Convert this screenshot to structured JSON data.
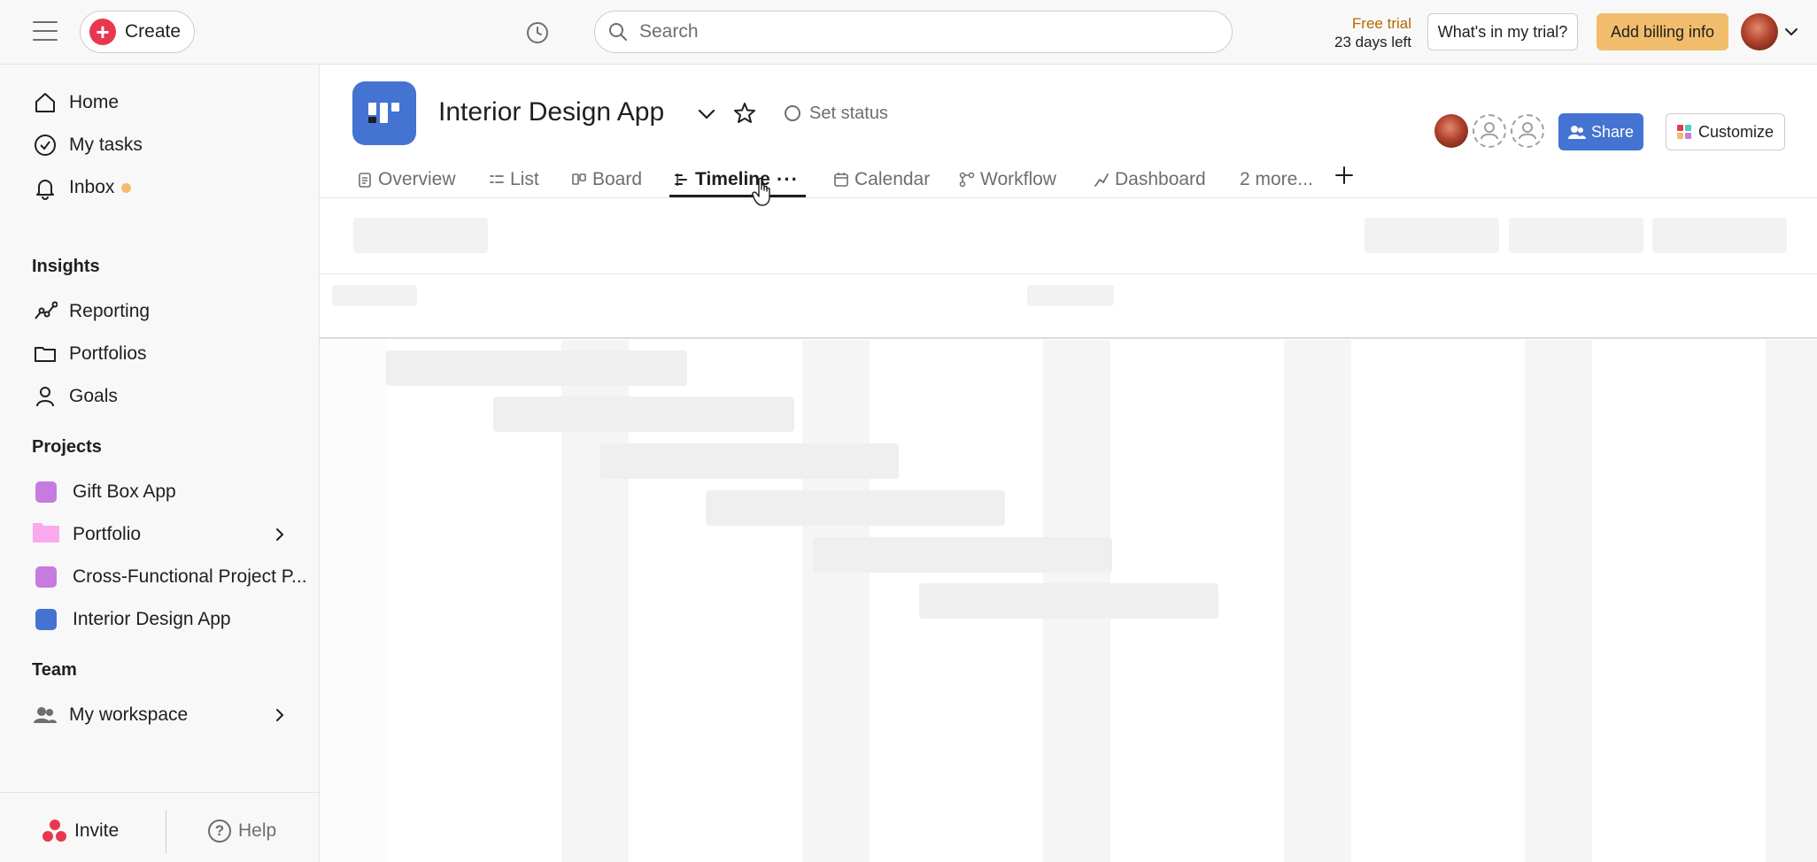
{
  "topbar": {
    "create_label": "Create",
    "search_placeholder": "Search",
    "trial_line1": "Free trial",
    "trial_line2": "23 days left",
    "whats_in_trial": "What's in my trial?",
    "add_billing": "Add billing info"
  },
  "sidebar": {
    "nav": [
      {
        "label": "Home",
        "icon": "home-icon"
      },
      {
        "label": "My tasks",
        "icon": "check-circle-icon"
      },
      {
        "label": "Inbox",
        "icon": "bell-icon"
      }
    ],
    "insights_title": "Insights",
    "insights": [
      {
        "label": "Reporting",
        "icon": "reporting-icon"
      },
      {
        "label": "Portfolios",
        "icon": "folder-icon"
      },
      {
        "label": "Goals",
        "icon": "goals-icon"
      }
    ],
    "projects_title": "Projects",
    "projects": [
      {
        "label": "Gift Box App",
        "color": "#c67be0"
      },
      {
        "label": "Portfolio",
        "color": "#f9aaef"
      },
      {
        "label": "Cross-Functional Project P...",
        "color": "#c67be0"
      },
      {
        "label": "Interior Design App",
        "color": "#4573d2"
      }
    ],
    "team_title": "Team",
    "team": [
      {
        "label": "My workspace",
        "icon": "people-icon"
      }
    ],
    "invite_label": "Invite",
    "help_label": "Help"
  },
  "project": {
    "title": "Interior Design App",
    "set_status": "Set status",
    "share_label": "Share",
    "customize_label": "Customize",
    "accent_color": "#4573d2"
  },
  "tabs": [
    {
      "label": "Overview",
      "icon": "overview-icon"
    },
    {
      "label": "List",
      "icon": "list-icon"
    },
    {
      "label": "Board",
      "icon": "board-icon"
    },
    {
      "label": "Timeline",
      "icon": "timeline-icon",
      "active": true
    },
    {
      "label": "Calendar",
      "icon": "calendar-icon"
    },
    {
      "label": "Workflow",
      "icon": "workflow-icon"
    },
    {
      "label": "Dashboard",
      "icon": "dashboard-icon"
    },
    {
      "label": "2 more...",
      "icon": null
    }
  ]
}
